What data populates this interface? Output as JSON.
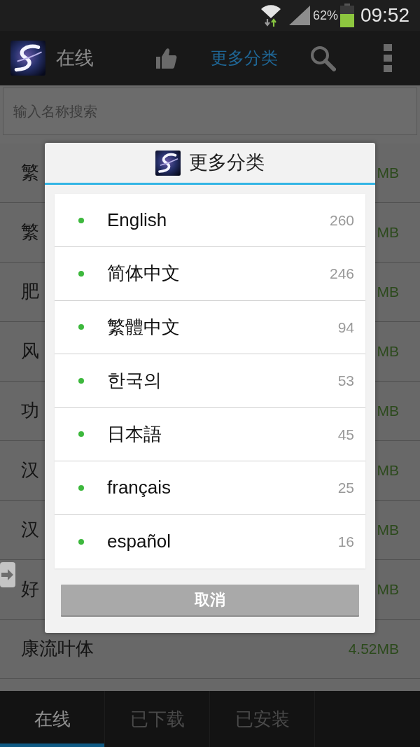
{
  "status_bar": {
    "battery": "62%",
    "time": "09:52"
  },
  "action_bar": {
    "title": "在线",
    "category_menu": "更多分类"
  },
  "search": {
    "placeholder": "输入名称搜索"
  },
  "font_list": [
    {
      "name": "繁",
      "size": "MB"
    },
    {
      "name": "繁",
      "size": "MB"
    },
    {
      "name": "肥",
      "size": "MB"
    },
    {
      "name": "风",
      "size": "MB"
    },
    {
      "name": "功",
      "size": "MB"
    },
    {
      "name": "汉",
      "size": "MB"
    },
    {
      "name": "汉",
      "size": "MB"
    },
    {
      "name": "好",
      "size": "MB"
    },
    {
      "name": "康流叶体",
      "size": "4.52MB"
    }
  ],
  "dialog": {
    "title": "更多分类",
    "items": [
      {
        "label": "English",
        "count": "260"
      },
      {
        "label": "简体中文",
        "count": "246"
      },
      {
        "label": "繁體中文",
        "count": "94"
      },
      {
        "label": "한국의",
        "count": "53"
      },
      {
        "label": "日本語",
        "count": "45"
      },
      {
        "label": "français",
        "count": "25"
      },
      {
        "label": "español",
        "count": "16"
      }
    ],
    "cancel_button": "取消"
  },
  "bottom_tabs": [
    {
      "label": "在线",
      "selected": true
    },
    {
      "label": "已下载",
      "selected": false
    },
    {
      "label": "已安装",
      "selected": false
    }
  ]
}
